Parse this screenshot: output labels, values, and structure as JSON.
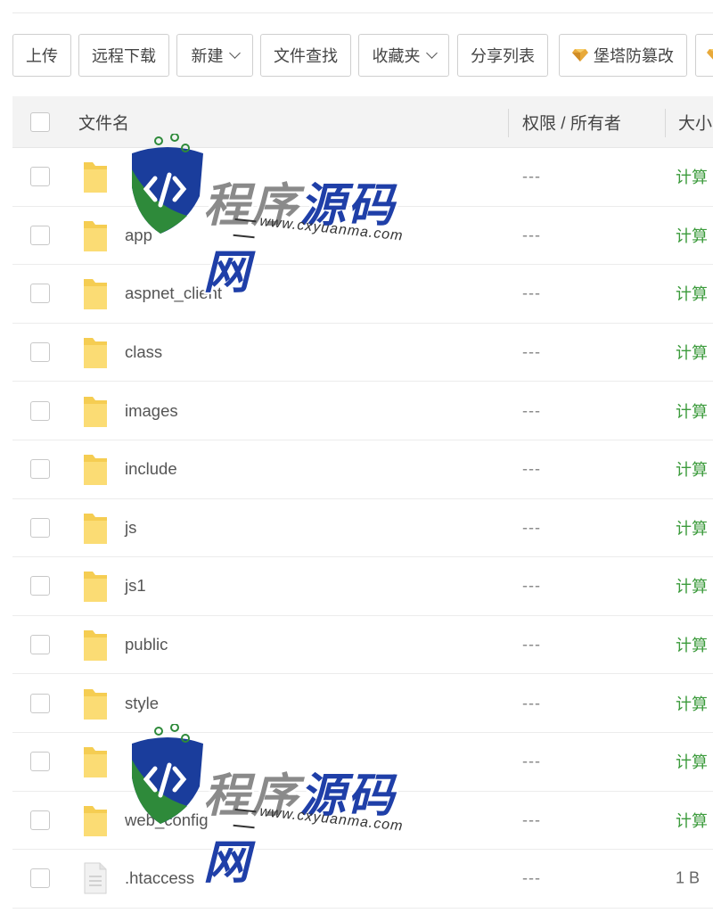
{
  "toolbar": {
    "buttons": [
      {
        "label": "上传",
        "dropdown": false,
        "icon": ""
      },
      {
        "label": "远程下载",
        "dropdown": false,
        "icon": ""
      },
      {
        "label": "新建",
        "dropdown": true,
        "icon": ""
      },
      {
        "label": "文件查找",
        "dropdown": false,
        "icon": ""
      },
      {
        "label": "收藏夹",
        "dropdown": true,
        "icon": ""
      },
      {
        "label": "分享列表",
        "dropdown": false,
        "icon": ""
      },
      {
        "label": "堡塔防篡改",
        "dropdown": false,
        "icon": "gem-icon"
      },
      {
        "label": "",
        "dropdown": false,
        "icon": "gem-icon"
      }
    ]
  },
  "table": {
    "headers": {
      "name": "文件名",
      "permission": "权限 / 所有者",
      "size": "大小"
    },
    "rows": [
      {
        "name": "",
        "type": "folder",
        "permission": "---",
        "size": "计算"
      },
      {
        "name": "app",
        "type": "folder",
        "permission": "---",
        "size": "计算"
      },
      {
        "name": "aspnet_client",
        "type": "folder",
        "permission": "---",
        "size": "计算"
      },
      {
        "name": "class",
        "type": "folder",
        "permission": "---",
        "size": "计算"
      },
      {
        "name": "images",
        "type": "folder",
        "permission": "---",
        "size": "计算"
      },
      {
        "name": "include",
        "type": "folder",
        "permission": "---",
        "size": "计算"
      },
      {
        "name": "js",
        "type": "folder",
        "permission": "---",
        "size": "计算"
      },
      {
        "name": "js1",
        "type": "folder",
        "permission": "---",
        "size": "计算"
      },
      {
        "name": "public",
        "type": "folder",
        "permission": "---",
        "size": "计算"
      },
      {
        "name": "style",
        "type": "folder",
        "permission": "---",
        "size": "计算"
      },
      {
        "name": "",
        "type": "folder",
        "permission": "---",
        "size": "计算"
      },
      {
        "name": "web_config",
        "type": "folder",
        "permission": "---",
        "size": "计算"
      },
      {
        "name": ".htaccess",
        "type": "file",
        "permission": "---",
        "size": "1 B"
      }
    ]
  },
  "watermark": {
    "title_gray": "程序",
    "title_blue": "源码网",
    "url": "www.cxyuanma.com"
  },
  "colors": {
    "accent_green": "#3c9b3c",
    "folder_yellow": "#f5cd52",
    "watermark_blue": "#1f3fa8"
  }
}
